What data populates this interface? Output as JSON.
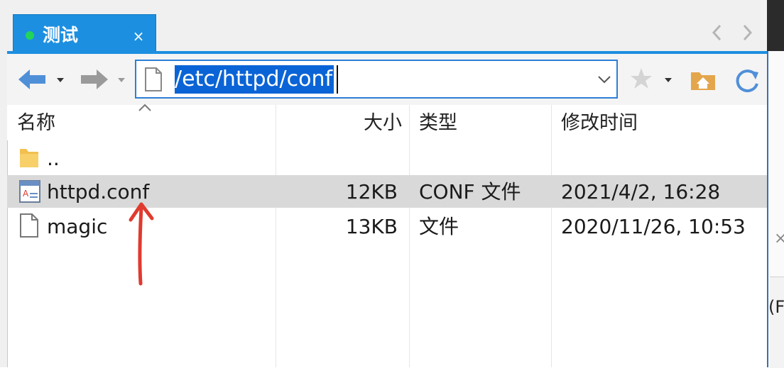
{
  "tab": {
    "title": "测试",
    "close_glyph": "×",
    "status_color": "#22d45a"
  },
  "toolbar": {
    "address": "/etc/httpd/conf",
    "icons": [
      "back-arrow-icon",
      "forward-arrow-icon",
      "document-icon",
      "chevron-down-icon",
      "star-icon",
      "home-folder-icon",
      "refresh-icon"
    ]
  },
  "columns": {
    "name": "名称",
    "size": "大小",
    "type": "类型",
    "modified": "修改时间"
  },
  "files": [
    {
      "name": "..",
      "size": "",
      "type": "",
      "modified": "",
      "icon": "folder-icon"
    },
    {
      "name": "httpd.conf",
      "size": "12KB",
      "type": "CONF 文件",
      "modified": "2021/4/2, 16:28",
      "icon": "conf-file-icon",
      "selected": true
    },
    {
      "name": "magic",
      "size": "13KB",
      "type": "文件",
      "modified": "2020/11/26, 10:53",
      "icon": "file-icon"
    }
  ],
  "side_panel": {
    "close_glyph": "×",
    "partial_label": "(F"
  },
  "colors": {
    "accent": "#1d8fe0",
    "selection": "#0a64d6",
    "row_highlight": "#d9d9d9",
    "annotation": "#e03a2f"
  }
}
